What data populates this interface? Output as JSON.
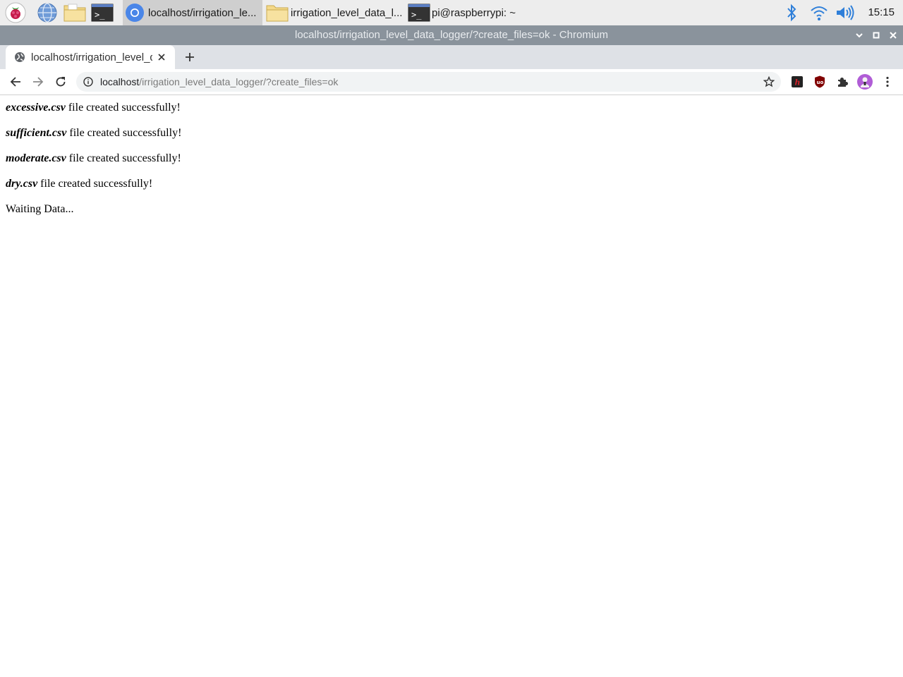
{
  "taskbar": {
    "launchers": [
      "raspberry-menu",
      "web-browser",
      "file-manager",
      "terminal"
    ],
    "tasks": [
      {
        "label": "localhost/irrigation_le...",
        "icon": "chromium-icon",
        "active": true
      },
      {
        "label": "irrigation_level_data_l...",
        "icon": "folder-icon",
        "active": false
      },
      {
        "label": "pi@raspberrypi: ~",
        "icon": "terminal-icon",
        "active": false
      }
    ],
    "tray": [
      "bluetooth-icon",
      "wifi-icon",
      "volume-icon"
    ],
    "clock": "15:15"
  },
  "window": {
    "title": "localhost/irrigation_level_data_logger/?create_files=ok - Chromium"
  },
  "browser": {
    "tab_title": "localhost/irrigation_level_data_logger/?create_files=ok",
    "url_host": "localhost",
    "url_rest": "/irrigation_level_data_logger/?create_files=ok",
    "extensions": [
      "h-extension-icon",
      "ublock-icon",
      "puzzle-icon",
      "profile-avatar"
    ]
  },
  "page": {
    "messages": [
      {
        "file": "excessive.csv",
        "text": " file created successfully!"
      },
      {
        "file": "sufficient.csv",
        "text": " file created successfully!"
      },
      {
        "file": "moderate.csv",
        "text": " file created successfully!"
      },
      {
        "file": "dry.csv",
        "text": " file created successfully!"
      }
    ],
    "status": "Waiting Data..."
  },
  "colors": {
    "titlebar": "#8a939c",
    "tabstrip": "#dee1e6",
    "accent_blue": "#1a73e8"
  }
}
